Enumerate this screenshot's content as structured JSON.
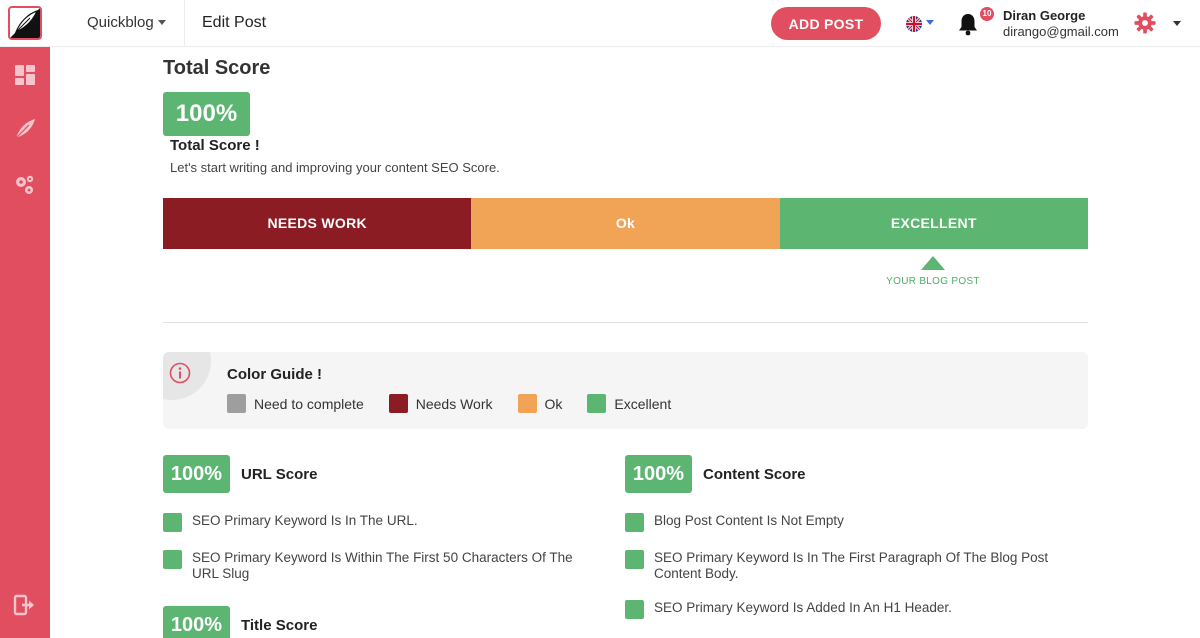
{
  "topbar": {
    "brand": "Quickblog",
    "page_title": "Edit Post",
    "add_post_label": "ADD POST",
    "notification_count": "10",
    "user_name": "Diran George",
    "user_email": "dirango@gmail.com"
  },
  "colors": {
    "accent": "#e04e60",
    "needs_work": "#8b1c24",
    "ok": "#f2a456",
    "excellent": "#5cb571",
    "need_to_complete": "#9e9e9e"
  },
  "icons": {
    "logo": "quill-logo-icon",
    "flag": "uk-flag-icon",
    "bell": "bell-icon",
    "gear": "gear-icon",
    "sidebar": [
      "dashboard-icon",
      "feather-icon",
      "gears-icon",
      "logout-icon"
    ],
    "info": "info-icon"
  },
  "total": {
    "heading": "Total Score",
    "score": "100%",
    "label": "Total Score !",
    "description": "Let's start writing and improving your content SEO Score."
  },
  "scale": {
    "needs_work": "NEEDS WORK",
    "ok": "Ok",
    "excellent": "EXCELLENT",
    "marker_label": "YOUR BLOG POST"
  },
  "guide": {
    "title": "Color Guide !",
    "items": [
      "Need to complete",
      "Needs Work",
      "Ok",
      "Excellent"
    ]
  },
  "url_score": {
    "score": "100%",
    "title": "URL Score",
    "items": [
      "SEO Primary Keyword Is In The URL.",
      "SEO Primary Keyword Is Within The First 50 Characters Of The URL Slug"
    ]
  },
  "title_score": {
    "score": "100%",
    "title": "Title Score"
  },
  "content_score": {
    "score": "100%",
    "title": "Content Score",
    "items": [
      "Blog Post Content Is Not Empty",
      "SEO Primary Keyword Is In The First Paragraph Of The Blog Post Content Body.",
      "SEO Primary Keyword Is Added In An H1 Header."
    ]
  }
}
